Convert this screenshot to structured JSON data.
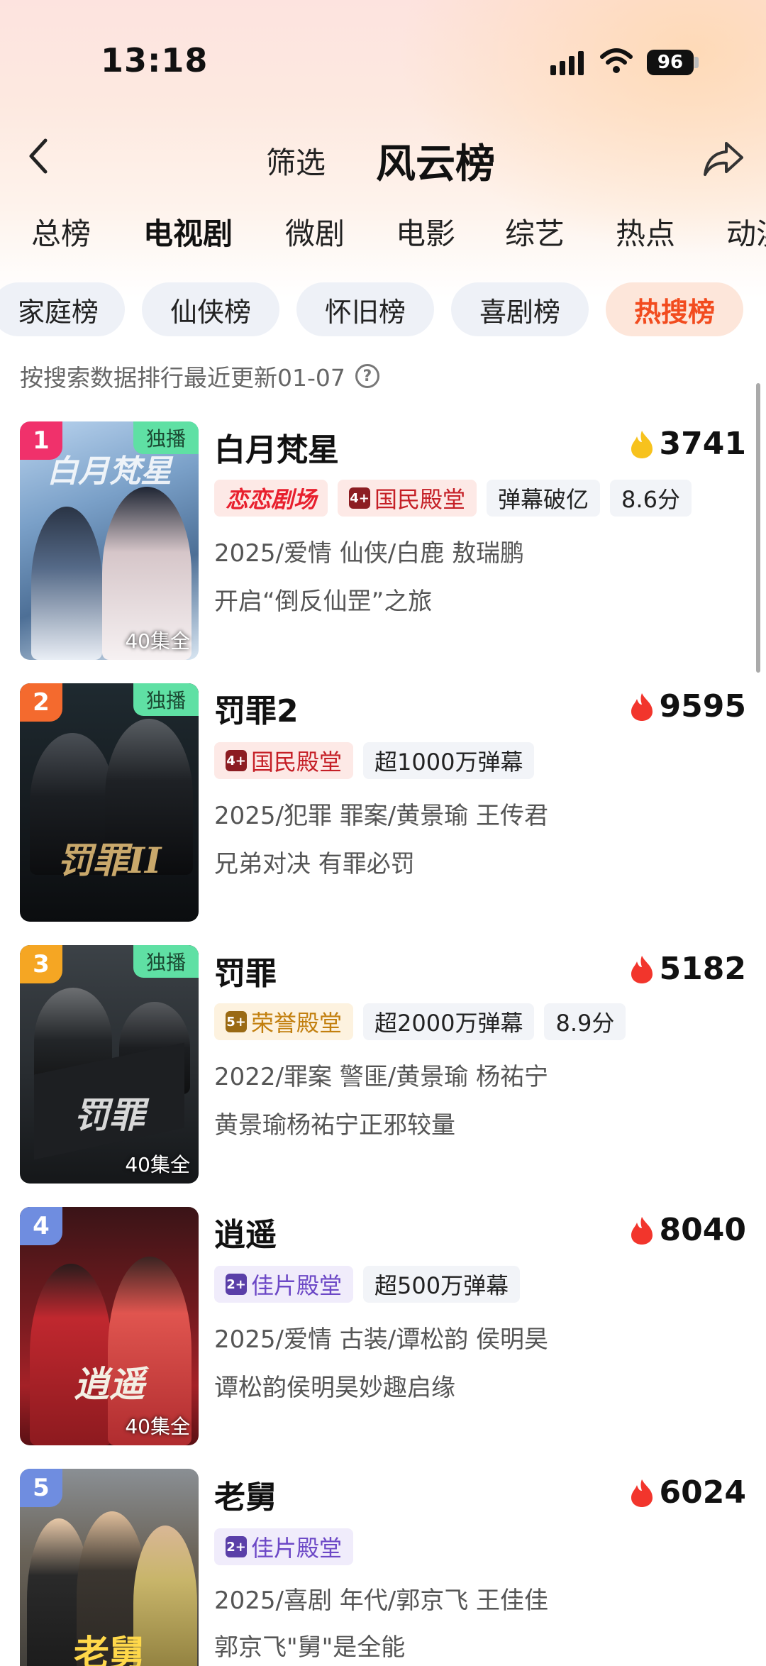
{
  "status_bar": {
    "time": "13:18",
    "battery": "96"
  },
  "header": {
    "filter_label": "筛选",
    "title": "风云榜"
  },
  "tabs": [
    "总榜",
    "电视剧",
    "微剧",
    "电影",
    "综艺",
    "热点",
    "动漫"
  ],
  "active_tab": "电视剧",
  "chips": [
    "家庭榜",
    "仙侠榜",
    "怀旧榜",
    "喜剧榜",
    "热搜榜"
  ],
  "active_chip": "热搜榜",
  "update_text": "按搜索数据排行最近更新01-07",
  "colors": {
    "accent": "#f24c1f",
    "flame_red": "#f2352c",
    "flame_yellow": "#f7c21d",
    "exclusive_green": "#5fe0a4"
  },
  "items": [
    {
      "rank": "1",
      "name": "白月梵星",
      "heat": "3741",
      "flame": "yellow",
      "exclusive": "独播",
      "episodes": "40集全",
      "poster_text": "白月梵星",
      "tags": [
        {
          "text": "恋恋剧场",
          "type": "brand"
        },
        {
          "text": "国民殿堂",
          "type": "hall-red",
          "badge": "4+"
        },
        {
          "text": "弹幕破亿"
        },
        {
          "text": "8.6分"
        }
      ],
      "meta": "2025/爱情 仙侠/白鹿 敖瑞鹏",
      "desc": "开启“倒反仙罡”之旅"
    },
    {
      "rank": "2",
      "name": "罚罪2",
      "heat": "9595",
      "flame": "red",
      "exclusive": "独播",
      "episodes": "",
      "poster_text": "罚罪II",
      "tags": [
        {
          "text": "国民殿堂",
          "type": "hall-red",
          "badge": "4+"
        },
        {
          "text": "超1000万弹幕"
        }
      ],
      "meta": "2025/犯罪 罪案/黄景瑜 王传君",
      "desc": "兄弟对决 有罪必罚"
    },
    {
      "rank": "3",
      "name": "罚罪",
      "heat": "5182",
      "flame": "red",
      "exclusive": "独播",
      "episodes": "40集全",
      "poster_text": "罚罪",
      "tags": [
        {
          "text": "荣誉殿堂",
          "type": "hall-gold",
          "badge": "5+"
        },
        {
          "text": "超2000万弹幕"
        },
        {
          "text": "8.9分"
        }
      ],
      "meta": "2022/罪案 警匪/黄景瑜 杨祐宁",
      "desc": "黄景瑜杨祐宁正邪较量"
    },
    {
      "rank": "4",
      "name": "逍遥",
      "heat": "8040",
      "flame": "red",
      "exclusive": "",
      "episodes": "40集全",
      "poster_text": "逍遥",
      "tags": [
        {
          "text": "佳片殿堂",
          "type": "hall-purple",
          "badge": "2+"
        },
        {
          "text": "超500万弹幕"
        }
      ],
      "meta": "2025/爱情 古装/谭松韵 侯明昊",
      "desc": "谭松韵侯明昊妙趣启缘"
    },
    {
      "rank": "5",
      "name": "老舅",
      "heat": "6024",
      "flame": "red",
      "exclusive": "",
      "episodes": "",
      "poster_text": "老舅",
      "tags": [
        {
          "text": "佳片殿堂",
          "type": "hall-purple",
          "badge": "2+"
        }
      ],
      "meta": "2025/喜剧 年代/郭京飞 王佳佳",
      "desc": "郭京飞\"舅\"是全能"
    }
  ]
}
